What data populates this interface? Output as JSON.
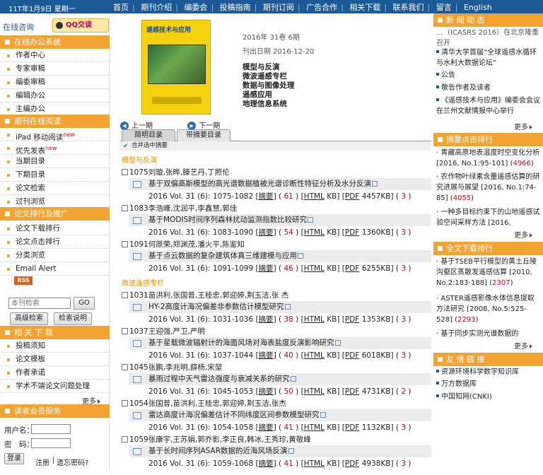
{
  "topbar": {
    "date": "11T年1月9日 星期一",
    "nav": [
      "首页",
      "期刊介绍",
      "编委会",
      "投稿指南",
      "期刊订阅",
      "广告合作",
      "相关下载",
      "联系我们",
      "留言",
      "English"
    ]
  },
  "left": {
    "consult": "在线咨询",
    "qq": "QQ交谈",
    "office_head": "在线办公系统",
    "office_items": [
      "作者中心",
      "专家审稿",
      "编委审稿",
      "编辑办公",
      "主编办公"
    ],
    "journal_head": "期刊在线阅读",
    "journal_items": [
      "iPad 移动阅读",
      "优先发表",
      "当期目录",
      "下期目录",
      "论文检索",
      "过刊浏览"
    ],
    "new_badge": "new",
    "rank_head": "论文排行及推广",
    "rank_items": [
      "论文下载排行",
      "论文点击排行",
      "分类浏览",
      "Email Alert"
    ],
    "rss": "RSS",
    "search_placeholder": "本刊检索",
    "go": "GO",
    "adv_search": "高级检索",
    "search_help": "检索说明",
    "download_head": "相 关 下 载",
    "download_items": [
      "投稿须知",
      "论文模板",
      "作者承诺",
      "学术不端论文问题处理"
    ],
    "more": "更多",
    "member_head": "读者会员服务",
    "username_label": "用户名：",
    "password_label": "密　码：",
    "login": "登录",
    "register": "注册",
    "forgot": "遗忘密码?"
  },
  "issue": {
    "cover_title": "遥感技术与应用",
    "volume": "2016年 31卷 6期",
    "pubdate": "刊出日期  2016-12-20",
    "columns": [
      "模型与反演",
      "微波遥感专栏",
      "数据与图像处理",
      "遥感应用",
      "地理信息系统"
    ],
    "prev": "上一期",
    "next": "下一期",
    "tab1": "简明目录",
    "tab2": "带摘要目录",
    "merge": "合并选中摘要"
  },
  "sections": [
    {
      "name": "模型与反演",
      "articles": [
        {
          "row1": "1075刘璇,张晔,滕艺丹,丁照伦",
          "title": "基于双偏高斯模型的高光谱数据植被光谱诊断性特征分析及水分反演",
          "info": "2016 Vol. 31 (6): 1075-1082",
          "clicks": "61",
          "size": "4457KB",
          "dl": "3"
        },
        {
          "row1": "1083李浩峰,沈润平,李鑫慧,郭佳",
          "title": "基于MODIS时间序列森林扰动监测指数比较研究",
          "info": "2016 Vol. 31 (6): 1083-1090",
          "clicks": "54",
          "size": "1360KB",
          "dl": "3"
        },
        {
          "row1": "1091何原荣,郑渊茂,潘火平,陈鉴知",
          "title": "基于点云数据的复杂建筑体真三维建模与应用",
          "info": "2016 Vol. 31 (6): 1091-1099",
          "clicks": "46",
          "size": "6255KB",
          "dl": "3"
        }
      ]
    },
    {
      "name": "微波遥感专栏",
      "articles": [
        {
          "row1": "1031苗洪利,张国普,王桂忠,郭迎婷,荆玉洁,张 杰",
          "title": "HY-2高度计海况偏差非参数估计模型研究",
          "info": "2016 Vol. 31 (6): 1031-1036",
          "clicks": "38",
          "size": "1353KB",
          "dl": "3"
        },
        {
          "row1": "1037王迎强,严卫,严明",
          "title": "基于星载微波辐射计的海面风场对海表盐度反演影响研究",
          "info": "2016 Vol. 31 (6): 1037-1044",
          "clicks": "40",
          "size": "6018KB",
          "dl": "3"
        },
        {
          "row1": "1045张鹏,李兆明,薛杨,宋堃",
          "title": "暴雨过程中天气雷达强度与衰减关系的研究",
          "info": "2016 Vol. 31 (6): 1045-1053",
          "clicks": "50",
          "size": "4731KB",
          "dl": "2"
        },
        {
          "row1": "1054张国普,苗洪利,王桂忠,郭迎婷,荆玉洁,张杰",
          "title": "雷达高度计海况偏差估计不同纬度区间参数模型研究",
          "info": "2016 Vol. 31 (6): 1054-1058",
          "clicks": "41",
          "size": "1132KB",
          "dl": "3"
        },
        {
          "row1": "1059张康宇,王苏娟,郭乔影,李正良,韩冰,王秀珍,黄敬峰",
          "title": "基于长时间序列ASAR数据的近海风场反演",
          "info": "2016 Vol. 31 (6): 1059-1068",
          "clicks": "41",
          "size": "4938KB",
          "dl": "3"
        }
      ]
    }
  ],
  "labels": {
    "abstract": "摘要",
    "html": "HTML",
    "kb": "KB",
    "pdf": "PDF"
  },
  "right": {
    "news_head": "新 闻 动 态",
    "news": [
      "…（ICASRS 2016）在北京隆重召开",
      "清华大学首届“全球遥感水循环与水利大数据论坛”",
      "公告",
      "敬告作者及读者",
      "《遥感技术与应用》编委会会议在兰州文献情报中心举行"
    ],
    "more": "更多",
    "click_head": "摘要点击排行",
    "click_items": [
      {
        "t": "青藏高原地表温度时空变化分析",
        "ref": "[2016, No.1:95-101] (",
        "n": "4966",
        "end": ")"
      },
      {
        "t": "农作物叶绿素含量遥感估算的研究进展与展望",
        "ref": "[2016, No.1:74-85] (",
        "n": "4055",
        "end": ")"
      },
      {
        "t": "一种多目标约束下的山地遥感试验空间采样方法",
        "ref": "[2016,",
        "n": "",
        "end": ""
      }
    ],
    "dl_head": "全文下载排行",
    "dl_items": [
      {
        "t": "基于TSEB平行模型的黄土丘陵沟壑区蒸散发遥感估算",
        "ref": "[2010, No.2:183-188] (",
        "n": "2307",
        "end": ")"
      },
      {
        "t": "ASTER遥感影像水体信息提取方法研究",
        "ref": "[2008, No.5:525-528] (",
        "n": "2293",
        "end": ")"
      },
      {
        "t": "基于同步实测光谱数据的ASTER",
        "ref": "",
        "n": "",
        "end": ""
      }
    ],
    "links_head": "友 情 链 接",
    "links": [
      "资源环境科学数字知识库",
      "万方数据库",
      "中国知网(CNKI)"
    ]
  },
  "colors": {
    "topbar": "#1b5a97",
    "accent": "#f3a331",
    "red": "#d2001f"
  }
}
